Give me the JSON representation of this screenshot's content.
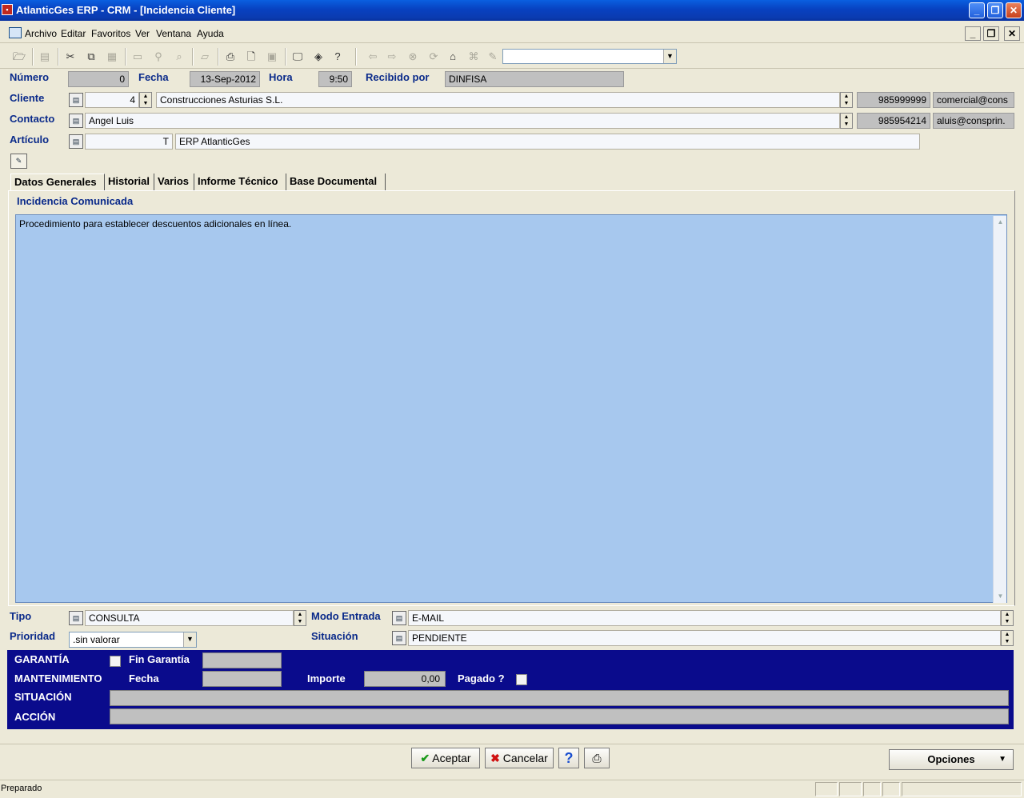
{
  "window": {
    "title": "AtlanticGes ERP - CRM - [Incidencia Cliente]"
  },
  "menu": [
    "Archivo",
    "Editar",
    "Favoritos",
    "Ver",
    "Ventana",
    "Ayuda"
  ],
  "header": {
    "numero_label": "Número",
    "numero_value": "0",
    "fecha_label": "Fecha",
    "fecha_value": "13-Sep-2012",
    "hora_label": "Hora",
    "hora_value": "9:50",
    "recibido_label": "Recibido por",
    "recibido_value": "DINFISA",
    "cliente_label": "Cliente",
    "cliente_code": "4",
    "cliente_name": "Construcciones Asturias S.L.",
    "cliente_phone": "985999999",
    "cliente_email": "comercial@cons",
    "contacto_label": "Contacto",
    "contacto_name": "Angel Luis",
    "contacto_phone": "985954214",
    "contacto_email": "aluis@consprin.",
    "articulo_label": "Artículo",
    "articulo_code": "T",
    "articulo_name": "ERP AtlanticGes"
  },
  "tabs": [
    "Datos Generales",
    "Historial",
    "Varios",
    "Informe Técnico",
    "Base Documental"
  ],
  "incidencia": {
    "label": "Incidencia Comunicada",
    "text": "Procedimiento para establecer descuentos adicionales en línea."
  },
  "details": {
    "tipo_label": "Tipo",
    "tipo_value": "CONSULTA",
    "modo_label": "Modo Entrada",
    "modo_value": "E-MAIL",
    "prioridad_label": "Prioridad",
    "prioridad_value": ".sin valorar",
    "situacion_label": "Situación",
    "situacion_value": "PENDIENTE"
  },
  "band": {
    "garantia": "GARANTÍA",
    "fin_garantia": "Fin Garantía",
    "mantenimiento": "MANTENIMIENTO",
    "fecha": "Fecha",
    "importe": "Importe",
    "importe_value": "0,00",
    "pagado": "Pagado ?",
    "situacion": "SITUACIÓN",
    "accion": "ACCIÓN"
  },
  "buttons": {
    "aceptar": "Aceptar",
    "cancelar": "Cancelar",
    "opciones": "Opciones"
  },
  "status": {
    "text": "Preparado"
  },
  "colors": {
    "title_bar": "#0a46c8",
    "band": "#0a0b8c",
    "text_area": "#a7c8ee",
    "label": "#0a2a8a"
  }
}
